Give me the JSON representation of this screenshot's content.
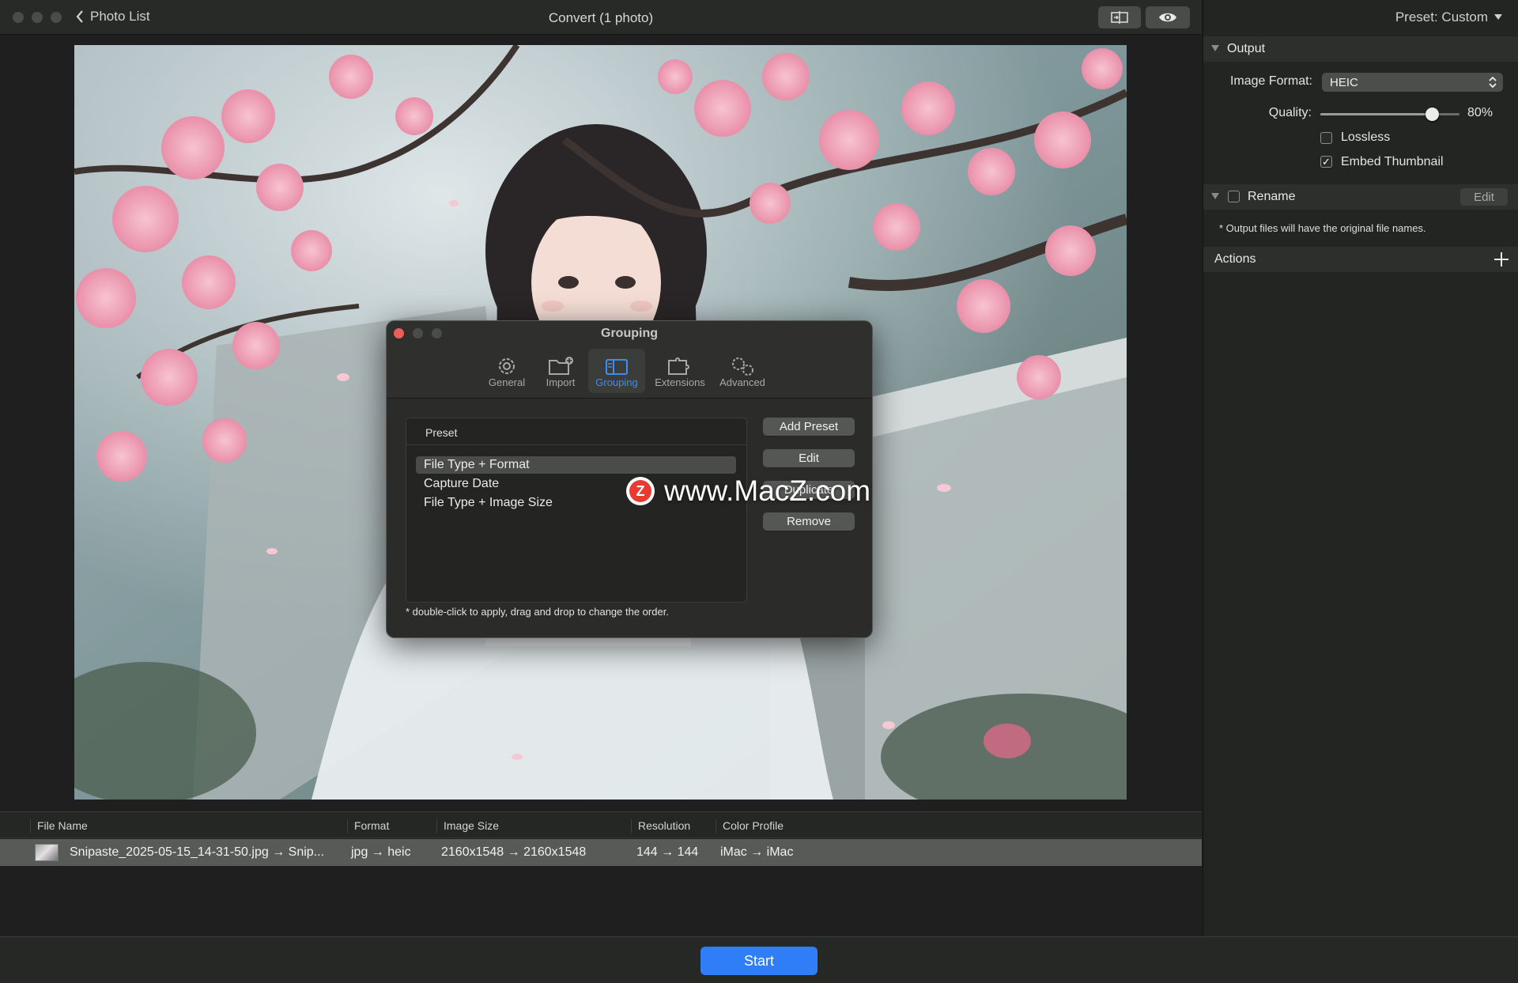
{
  "titlebar": {
    "back_label": "Photo List",
    "title": "Convert (1 photo)",
    "compare_icon": "split-compare-icon",
    "preview_icon": "eye-icon"
  },
  "table": {
    "columns": [
      "File Name",
      "Format",
      "Image Size",
      "Resolution",
      "Color Profile"
    ],
    "rows": [
      {
        "file_name": "Snipaste_2025-05-15_14-31-50.jpg → Snip...",
        "format": "jpg → heic",
        "image_size": "2160x1548 → 2160x1548",
        "resolution": "144 → 144",
        "color_profile": "iMac → iMac"
      }
    ]
  },
  "start_label": "Start",
  "sidebar": {
    "preset": "Preset: Custom",
    "output": {
      "title": "Output",
      "image_format_label": "Image Format:",
      "image_format_value": "HEIC",
      "quality_label": "Quality:",
      "quality_value": "80%",
      "quality_fraction": 0.8,
      "lossless_label": "Lossless",
      "lossless_checked": false,
      "embed_label": "Embed Thumbnail",
      "embed_checked": true
    },
    "rename": {
      "title": "Rename",
      "checked": false,
      "edit_label": "Edit",
      "note": "* Output files will have the original file names."
    },
    "actions": {
      "title": "Actions"
    }
  },
  "dialog": {
    "title": "Grouping",
    "tabs": [
      {
        "label": "General",
        "icon": "gear-icon"
      },
      {
        "label": "Import",
        "icon": "folder-add-icon"
      },
      {
        "label": "Grouping",
        "icon": "sidebar-icon",
        "active": true
      },
      {
        "label": "Extensions",
        "icon": "puzzle-icon"
      },
      {
        "label": "Advanced",
        "icon": "gears-icon"
      }
    ],
    "list_header": "Preset",
    "presets": [
      "File Type + Format",
      "Capture Date",
      "File Type + Image Size"
    ],
    "selected_preset": "File Type + Format",
    "buttons": {
      "add": "Add Preset",
      "edit": "Edit",
      "duplicate": "Duplicate",
      "remove": "Remove"
    },
    "note": "* double-click to apply, drag and drop to change the order."
  },
  "watermark": {
    "logo_letter": "Z",
    "text": "www.MacZ.com"
  },
  "colors": {
    "accent": "#2f7ef7",
    "active_tab": "#3f8cf2",
    "close": "#ec5f57",
    "window_bg": "#1e1f1e"
  }
}
